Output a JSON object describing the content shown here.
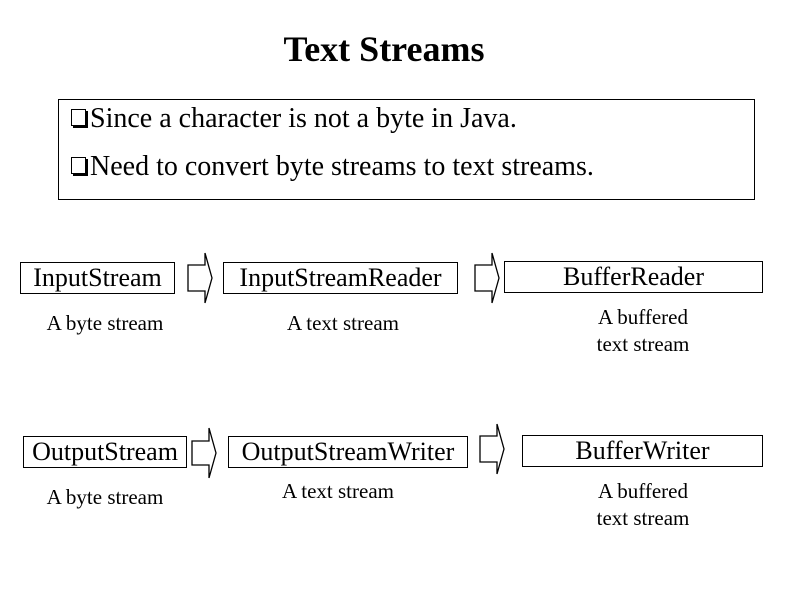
{
  "slide": {
    "title": "Text Streams",
    "bullets": [
      "Since a character is not a byte in Java.",
      "Need to convert byte streams to text streams."
    ]
  },
  "diagram": {
    "input_row": {
      "nodes": [
        {
          "label": "InputStream",
          "caption": "A byte stream"
        },
        {
          "label": "InputStreamReader",
          "caption": "A text stream"
        },
        {
          "label": "BufferReader",
          "caption_line1": "A buffered",
          "caption_line2": "text stream"
        }
      ]
    },
    "output_row": {
      "nodes": [
        {
          "label": "OutputStream",
          "caption": "A byte stream"
        },
        {
          "label": "OutputStreamWriter",
          "caption": "A text stream"
        },
        {
          "label": "BufferWriter",
          "caption_line1": "A buffered",
          "caption_line2": "text stream"
        }
      ]
    }
  }
}
